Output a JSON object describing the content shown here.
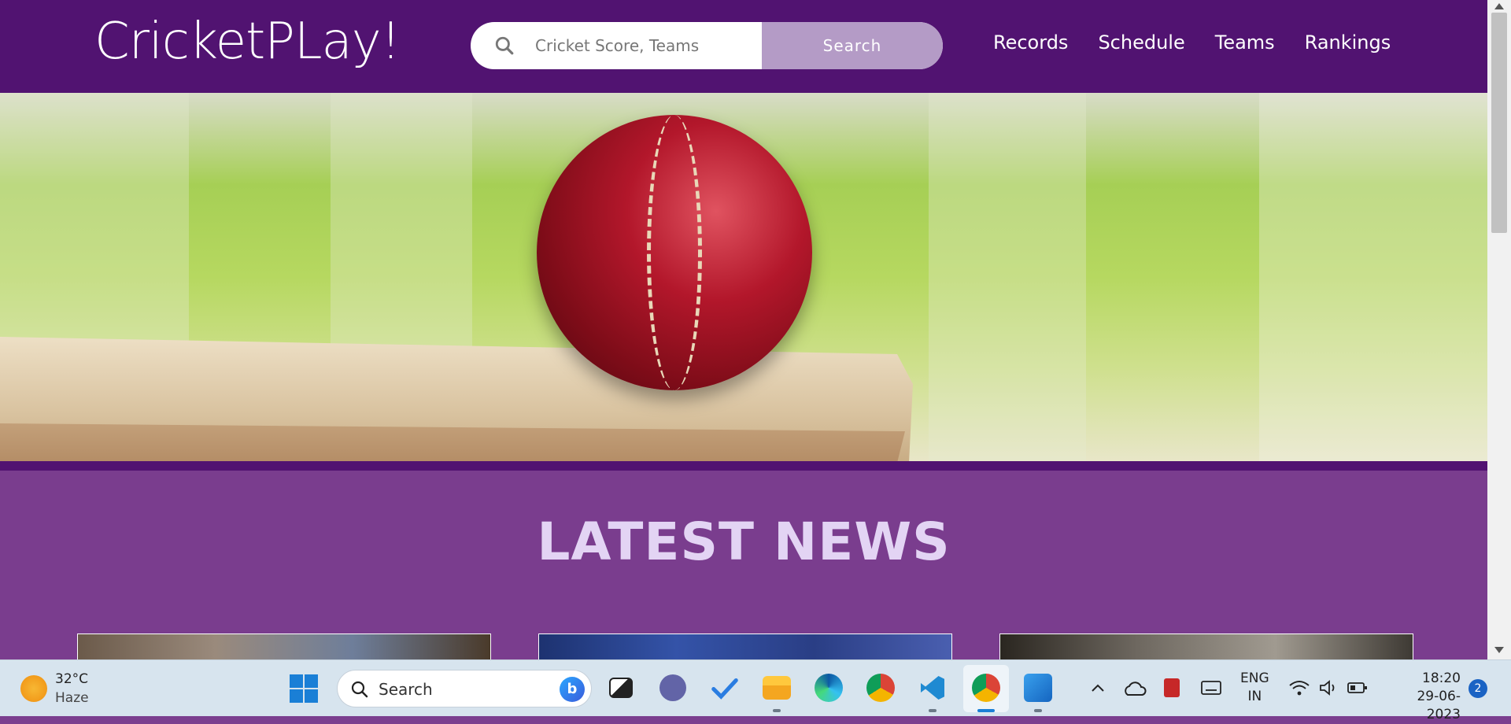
{
  "header": {
    "logo": "CricketPLay!",
    "search_placeholder": "Cricket Score, Teams",
    "search_button": "Search",
    "nav": [
      "Records",
      "Schedule",
      "Teams",
      "Rankings"
    ]
  },
  "hero": {
    "image": "cricket-ball-on-bat"
  },
  "news": {
    "title": "LATEST NEWS",
    "cards": [
      "news-card-1",
      "news-card-2",
      "news-card-3"
    ]
  },
  "taskbar": {
    "weather": {
      "temp": "32°C",
      "condition": "Haze"
    },
    "search_label": "Search",
    "apps": [
      "task-view",
      "teams-chat",
      "todo",
      "file-explorer",
      "edge",
      "chrome",
      "vscode",
      "chrome-profile",
      "photos"
    ],
    "lang": {
      "line1": "ENG",
      "line2": "IN"
    },
    "clock": {
      "time": "18:20",
      "date": "29-06-2023"
    },
    "notifications": "2"
  },
  "colors": {
    "header_bg": "#511371",
    "section_bg": "#7a3d8e",
    "search_button_bg": "#b49bc6",
    "news_title": "#e3d4f4"
  }
}
